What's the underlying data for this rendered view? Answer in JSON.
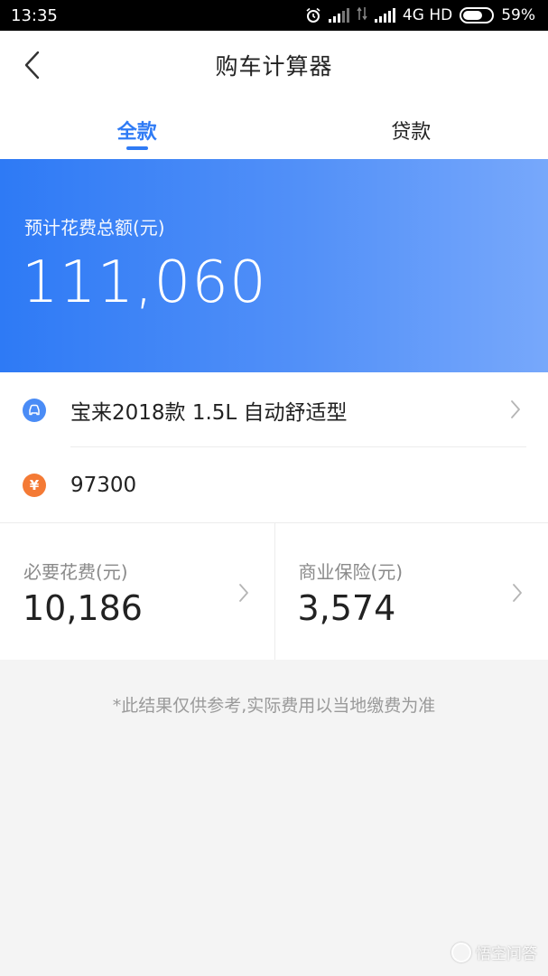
{
  "status_bar": {
    "time": "13:35",
    "network": "4G HD",
    "battery": "59%",
    "icons": [
      "alarm-icon",
      "signal-icon",
      "data-arrows-icon",
      "signal-icon",
      "battery-icon"
    ]
  },
  "nav": {
    "title": "购车计算器",
    "back_icon": "chevron-left-icon"
  },
  "tabs": [
    {
      "label": "全款",
      "active": true
    },
    {
      "label": "贷款",
      "active": false
    }
  ],
  "summary": {
    "label": "预计花费总额(元)",
    "amount": "111,060"
  },
  "car": {
    "icon": "car-icon",
    "name": "宝来2018款 1.5L 自动舒适型"
  },
  "price": {
    "icon": "yen-icon",
    "symbol": "¥",
    "value": "97300"
  },
  "costs": [
    {
      "label": "必要花费(元)",
      "value": "10,186"
    },
    {
      "label": "商业保险(元)",
      "value": "3,574"
    }
  ],
  "note": "*此结果仅供参考,实际费用以当地缴费为准",
  "watermark": "悟空问答",
  "colors": {
    "accent": "#2f7bf5",
    "hero_start": "#2e7af5",
    "hero_end": "#77a8fb",
    "yen_badge": "#f47a35",
    "car_badge": "#4a8cf6"
  }
}
